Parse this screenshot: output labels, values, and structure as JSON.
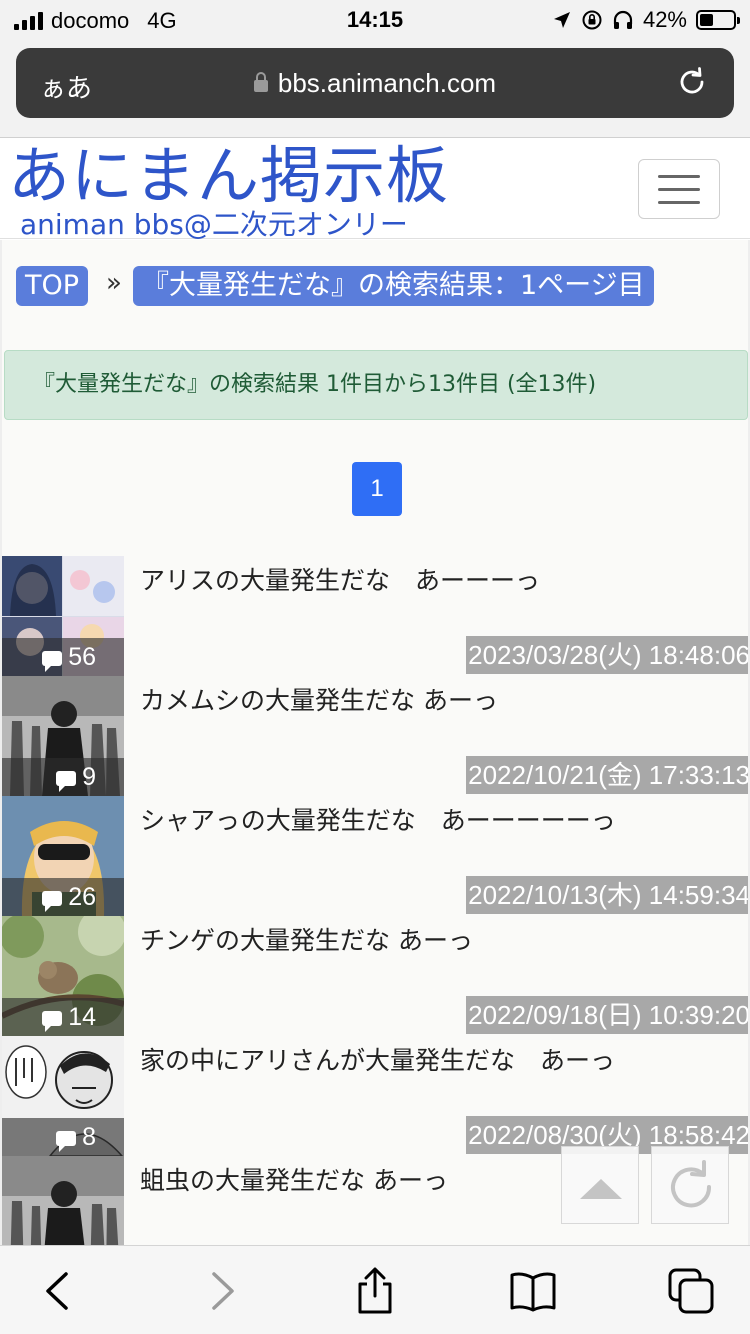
{
  "status_bar": {
    "carrier": "docomo",
    "network": "4G",
    "time": "14:15",
    "battery_percent": "42%",
    "battery_level": 0.42
  },
  "browser": {
    "aa_label": "ぁあ",
    "url": "bbs.animanch.com"
  },
  "site": {
    "logo_title": "あにまん掲示板",
    "logo_subtitle": "animan bbs@二次元オンリー"
  },
  "breadcrumb": {
    "top_label": "TOP",
    "separator": "»",
    "current_label": "『大量発生だな』の検索結果：1ページ目"
  },
  "search": {
    "result_summary": "『大量発生だな』の検索結果 1件目から13件目 (全13件)"
  },
  "pagination": {
    "current_page": "1"
  },
  "threads": [
    {
      "title": "アリスの大量発生だな　あーーーっ",
      "count": "56",
      "date": "2023/03/28(火) 18:48:06"
    },
    {
      "title": "カメムシの大量発生だな あーっ",
      "count": "9",
      "date": "2022/10/21(金) 17:33:13"
    },
    {
      "title": "シャアっの大量発生だな　あーーーーーっ",
      "count": "26",
      "date": "2022/10/13(木) 14:59:34"
    },
    {
      "title": "チンゲの大量発生だな あーっ",
      "count": "14",
      "date": "2022/09/18(日) 10:39:20"
    },
    {
      "title": "家の中にアリさんが大量発生だな　あーっ",
      "count": "8",
      "date": "2022/08/30(火) 18:58:42"
    },
    {
      "title": "蛆虫の大量発生だな あーっ",
      "count": "",
      "date": ""
    }
  ],
  "icons": {
    "scroll_top": "triangle-up-icon",
    "refresh": "refresh-icon"
  },
  "colors": {
    "logo": "#2e55c9",
    "breadcrumb": "#5a7ddb",
    "pagination_active": "#2f6ef5",
    "alert_bg": "#d4e9dc",
    "alert_text": "#1f5b36",
    "date_bg": "#a8a8a8"
  }
}
